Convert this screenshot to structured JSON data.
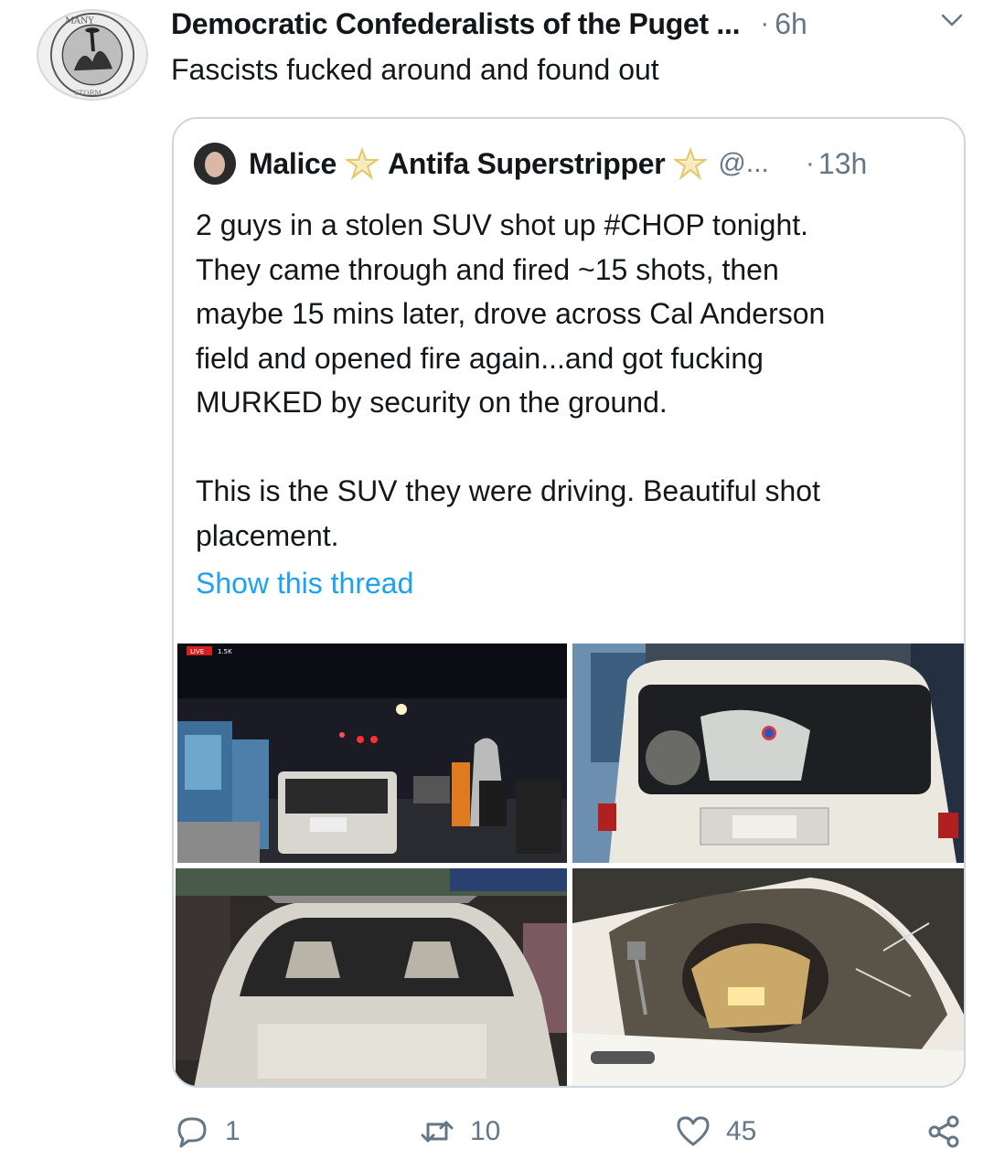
{
  "author": {
    "display_name": "Democratic Confederalists of the Puget ...",
    "separator": "·",
    "time": "6h",
    "avatar_icon": "circular-logo-icon",
    "avatar_text_top": "MANY",
    "avatar_text_bottom": "STORM"
  },
  "tweet": {
    "text": "Fascists fucked around and found out"
  },
  "quote": {
    "name_first": "Malice",
    "name_second": "Antifa Superstripper",
    "handle": "@...",
    "separator": "·",
    "time": "13h",
    "text": "2 guys in a stolen SUV shot up #CHOP tonight.\nThey came through and fired ~15 shots, then\nmaybe 15 mins later, drove across Cal Anderson\nfield and opened fire again...and got fucking\nMURKED by security on the ground.\n\nThis is the SUV they were driving. Beautiful shot\nplacement.",
    "show_thread": "Show this thread",
    "star_color": "#e8c66a",
    "photos": [
      {
        "name": "photo-street-night",
        "overlay_live": "LIVE",
        "overlay_views": "1.5K"
      },
      {
        "name": "photo-suv-rear"
      },
      {
        "name": "photo-suv-windshield"
      },
      {
        "name": "photo-shattered-window"
      }
    ]
  },
  "actions": {
    "replies": "1",
    "retweets": "10",
    "likes": "45"
  },
  "colors": {
    "link": "#1da1f2",
    "muted": "#657786",
    "border": "#ccd6dd"
  }
}
